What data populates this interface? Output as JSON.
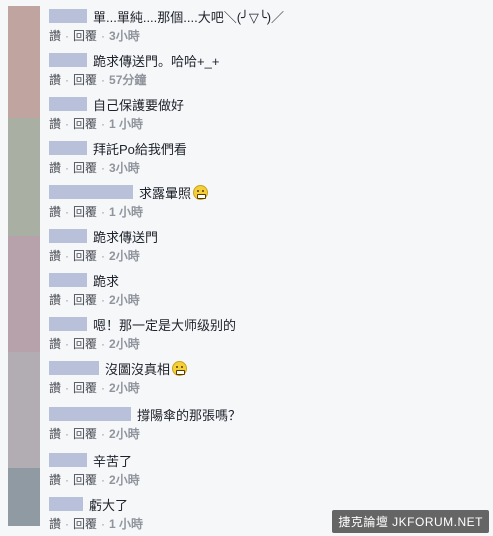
{
  "actions": {
    "like": "讚",
    "reply": "回覆",
    "separator": "·"
  },
  "stripe_colors": [
    "#bfa4a0",
    "#a9afa2",
    "#b7a2ab",
    "#b1adb3",
    "#8f9aa3"
  ],
  "comments": [
    {
      "text": "單...單純....那個....大吧＼(╯▽╰)／",
      "time": "3小時",
      "emoji": ""
    },
    {
      "text": "跪求傳送門。哈哈+_+",
      "time": "57分鐘",
      "emoji": ""
    },
    {
      "text": "自己保護要做好",
      "time": "1 小時",
      "emoji": ""
    },
    {
      "text": "拜託Po給我們看",
      "time": "3小時",
      "emoji": ""
    },
    {
      "text": "求露暈照",
      "time": "1 小時",
      "emoji": "grinning-emoji"
    },
    {
      "text": "跪求傳送門",
      "time": "2小時",
      "emoji": ""
    },
    {
      "text": "跪求",
      "time": "2小時",
      "emoji": ""
    },
    {
      "text": "嗯！那一定是大师级别的",
      "time": "2小時",
      "emoji": ""
    },
    {
      "text": "沒圖沒真相",
      "time": "2小時",
      "emoji": "grimacing-emoji"
    },
    {
      "text": "撐陽傘的那張嗎？",
      "time": "2小時",
      "emoji": ""
    },
    {
      "text": "辛苦了",
      "time": "2小時",
      "emoji": ""
    },
    {
      "text": "虧大了",
      "time": "1 小時",
      "emoji": ""
    }
  ],
  "watermark": "捷克論壇 JKFORUM.NET"
}
